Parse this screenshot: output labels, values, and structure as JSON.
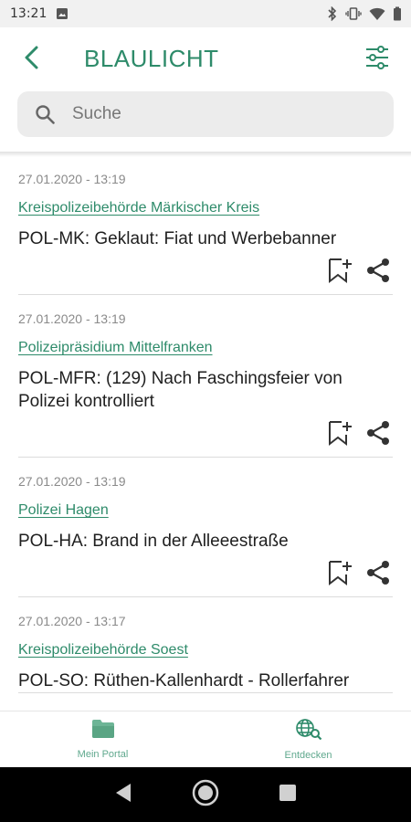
{
  "status_bar": {
    "time": "13:21"
  },
  "app_bar": {
    "title": "BLAULICHT"
  },
  "search": {
    "placeholder": "Suche"
  },
  "colors": {
    "accent": "#2e8b6a",
    "search_bg": "#ececec",
    "date_text": "#8a8a8a"
  },
  "articles": [
    {
      "date": "27.01.2020 - 13:19",
      "source": "Kreispolizeibehörde Märkischer Kreis",
      "headline": "POL-MK: Geklaut: Fiat und Werbebanner"
    },
    {
      "date": "27.01.2020 - 13:19",
      "source": "Polizeipräsidium Mittelfranken",
      "headline": "POL-MFR: (129) Nach Faschingsfeier von Polizei kontrolliert"
    },
    {
      "date": "27.01.2020 - 13:19",
      "source": "Polizei Hagen",
      "headline": "POL-HA: Brand in der Alleeestraße"
    },
    {
      "date": "27.01.2020 - 13:17",
      "source": "Kreispolizeibehörde Soest",
      "headline": "POL-SO: Rüthen-Kallenhardt - Rollerfahrer"
    }
  ],
  "bottom_nav": {
    "items": [
      {
        "label": "Mein Portal",
        "icon": "folder-icon"
      },
      {
        "label": "Entdecken",
        "icon": "globe-search-icon"
      }
    ]
  }
}
